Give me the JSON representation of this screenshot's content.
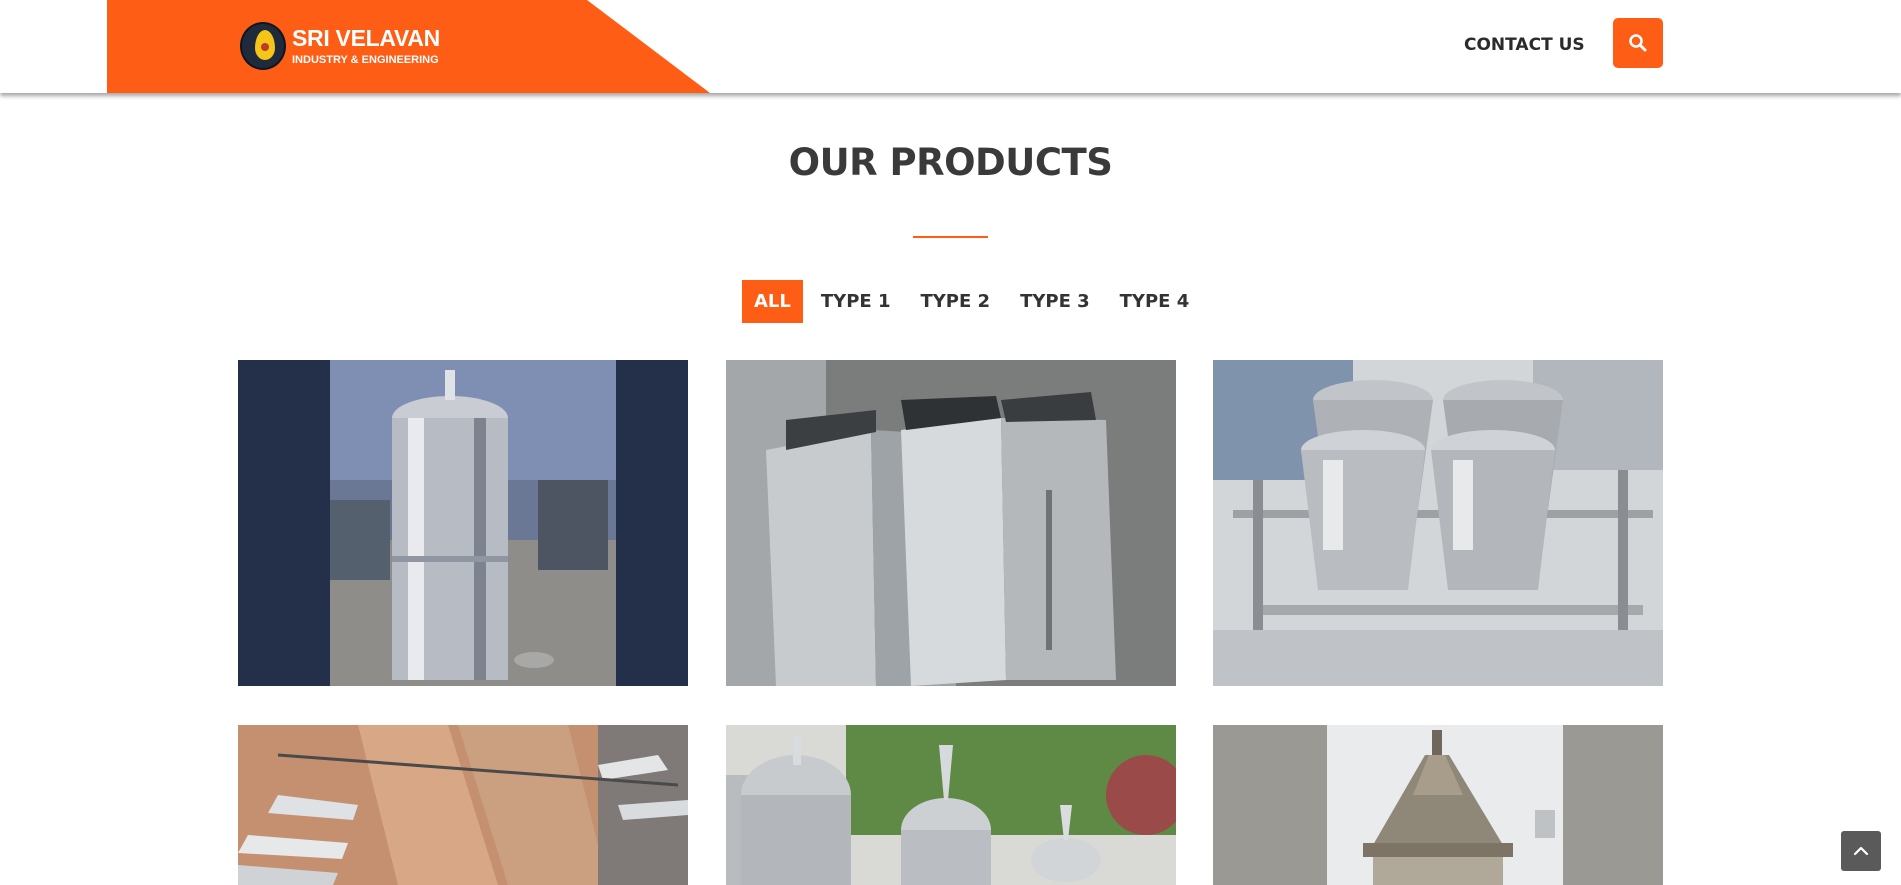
{
  "header": {
    "brand_name": "SRI VELAVAN",
    "brand_tagline": "INDUSTRY & ENGINEERING",
    "nav_contact": "CONTACT US",
    "search_icon": "search-icon"
  },
  "section": {
    "title": "OUR PRODUCTS"
  },
  "filters": [
    {
      "label": "ALL",
      "active": true
    },
    {
      "label": "TYPE 1",
      "active": false
    },
    {
      "label": "TYPE 2",
      "active": false
    },
    {
      "label": "TYPE 3",
      "active": false
    },
    {
      "label": "TYPE 4",
      "active": false
    }
  ],
  "products": [
    {
      "image": "stainless-steel-water-filter-tank"
    },
    {
      "image": "stainless-steel-square-bins"
    },
    {
      "image": "stainless-steel-buckets-in-rack"
    },
    {
      "image": "stainless-steel-channels-with-paper"
    },
    {
      "image": "stainless-steel-dome-vessels"
    },
    {
      "image": "decorative-steel-lamp-canopy"
    }
  ],
  "colors": {
    "accent": "#fd5d14",
    "text_dark": "#3a3a3a",
    "scroll_button": "#5a5a5a"
  }
}
